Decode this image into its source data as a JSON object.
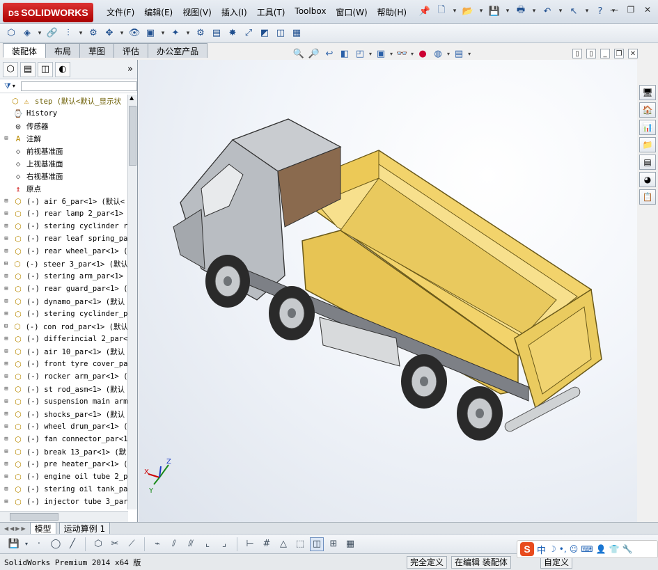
{
  "app": {
    "logo_text": "SOLIDWORKS",
    "logo_prefix": "DS"
  },
  "menu": [
    "文件(F)",
    "编辑(E)",
    "视图(V)",
    "插入(I)",
    "工具(T)",
    "Toolbox",
    "窗口(W)",
    "帮助(H)"
  ],
  "command_tabs": [
    "装配体",
    "布局",
    "草图",
    "评估",
    "办公室产品"
  ],
  "active_command_tab": 0,
  "tree": {
    "root_label": "step  (默认<默认_显示状",
    "items": [
      {
        "label": "History",
        "icon": "history-icon",
        "expandable": false
      },
      {
        "label": "传感器",
        "icon": "sensor-icon",
        "expandable": false
      },
      {
        "label": "注解",
        "icon": "annotation-icon",
        "expandable": true
      },
      {
        "label": "前视基准面",
        "icon": "plane-icon",
        "expandable": false
      },
      {
        "label": "上视基准面",
        "icon": "plane-icon",
        "expandable": false
      },
      {
        "label": "右视基准面",
        "icon": "plane-icon",
        "expandable": false
      },
      {
        "label": "原点",
        "icon": "origin-icon",
        "expandable": false
      },
      {
        "label": "(-) air 6_par<1> (默认<",
        "icon": "assembly-icon",
        "expandable": true
      },
      {
        "label": "(-) rear lamp 2_par<1>",
        "icon": "assembly-icon",
        "expandable": true
      },
      {
        "label": "(-) stering cyclinder r",
        "icon": "assembly-icon",
        "expandable": true
      },
      {
        "label": "(-) rear leaf spring_pa",
        "icon": "assembly-icon",
        "expandable": true
      },
      {
        "label": "(-) rear wheel_par<1> (",
        "icon": "assembly-icon",
        "expandable": true
      },
      {
        "label": "(-) steer 3_par<1> (默认",
        "icon": "assembly-icon",
        "expandable": true
      },
      {
        "label": "(-) stering arm_par<1>",
        "icon": "assembly-icon",
        "expandable": true
      },
      {
        "label": "(-) rear guard_par<1> (",
        "icon": "assembly-icon",
        "expandable": true
      },
      {
        "label": "(-) dynamo_par<1> (默认",
        "icon": "assembly-icon",
        "expandable": true
      },
      {
        "label": "(-) stering cyclinder_p",
        "icon": "assembly-icon",
        "expandable": true
      },
      {
        "label": "(-) con rod_par<1> (默认",
        "icon": "assembly-icon",
        "expandable": true
      },
      {
        "label": "(-) differincial 2_par<",
        "icon": "assembly-icon",
        "expandable": true
      },
      {
        "label": "(-) air 10_par<1> (默认",
        "icon": "assembly-icon",
        "expandable": true
      },
      {
        "label": "(-) front tyre cover_pa",
        "icon": "assembly-icon",
        "expandable": true
      },
      {
        "label": "(-) rocker arm_par<1> (",
        "icon": "assembly-icon",
        "expandable": true
      },
      {
        "label": "(-) st rod_asm<1> (默认",
        "icon": "assembly-icon",
        "expandable": true
      },
      {
        "label": "(-) suspension main arm",
        "icon": "assembly-icon",
        "expandable": true
      },
      {
        "label": "(-) shocks_par<1> (默认",
        "icon": "assembly-icon",
        "expandable": true
      },
      {
        "label": "(-) wheel drum_par<1> (",
        "icon": "assembly-icon",
        "expandable": true
      },
      {
        "label": "(-) fan connector_par<1",
        "icon": "assembly-icon",
        "expandable": true
      },
      {
        "label": "(-) break 13_par<1> (默",
        "icon": "assembly-icon",
        "expandable": true
      },
      {
        "label": "(-) pre heater_par<1> (",
        "icon": "assembly-icon",
        "expandable": true
      },
      {
        "label": "(-) engine oil tube 2_p",
        "icon": "assembly-icon",
        "expandable": true
      },
      {
        "label": "(-) stering oil tank_pa",
        "icon": "assembly-icon",
        "expandable": true
      },
      {
        "label": "(-) injector tube 3_par",
        "icon": "assembly-icon",
        "expandable": true
      }
    ]
  },
  "model_tabs": [
    "模型",
    "运动算例 1"
  ],
  "active_model_tab": 0,
  "triad": {
    "x": "X",
    "y": "Y",
    "z": "Z"
  },
  "status": {
    "product": "SolidWorks Premium 2014 x64 版",
    "definition": "完全定义",
    "mode": "在编辑 装配体",
    "custom": "自定义"
  },
  "ime": {
    "lang": "中"
  },
  "colors": {
    "truck_bed": "#f2d36b",
    "truck_cab": "#c9ccd0",
    "tyre": "#2a2a2a",
    "accent": "#1f4f8f"
  }
}
